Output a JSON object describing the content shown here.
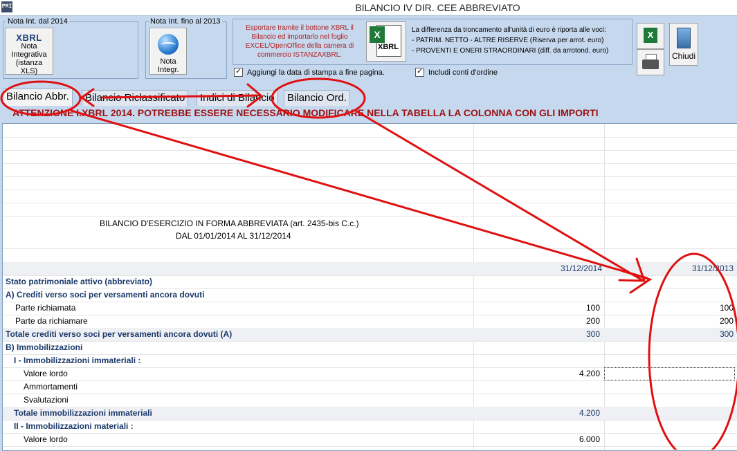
{
  "window": {
    "app_icon": "PMI",
    "title": "BILANCIO IV DIR. CEE ABBREVIATO"
  },
  "toolbar": {
    "group1_legend": "Nota Int. dal 2014",
    "group1_logo": "XBRL",
    "group1_button_label": "Nota Integrativa (istanza XLS)",
    "group2_legend": "Nota Int. fino al 2013",
    "group2_button_label": "Nota Integr.",
    "export_text": "Esportare tramite il bottone XBRL il Bilancio ed importarlo nel foglio EXCEL/OpenOffice della camera di commercio ISTANZAXBRL.",
    "xbrl_button_label": "XBRL",
    "rounding_note_line1": "La differenza da troncamento all'unità di euro è riporta alle voci:",
    "rounding_note_line2": "- PATRIM. NETTO - ALTRE RISERVE  (Riserva per arrot. euro)",
    "rounding_note_line3": "- PROVENTI E ONERI STRAORDINARI (diff. da  arrotond. euro)",
    "checkbox_print_date": "Aggiungi la data di stampa a fine pagina.",
    "checkbox_conti_ordine": "Includi conti d'ordine",
    "close_label": "Chiudi"
  },
  "tabs": [
    {
      "label": "Bilancio Abbr."
    },
    {
      "label": "Bilancio Riclassificato"
    },
    {
      "label": "Indici di Bilancio"
    },
    {
      "label": "Bilancio Ord."
    }
  ],
  "warning": "ATTENZIONE I.XBRL 2014. POTREBBE ESSERE NECESSARIO MODIFICARE NELLA TABELLA LA COLONNA CON GLI IMPORTI",
  "report": {
    "heading_line1": "BILANCIO D'ESERCIZIO IN FORMA ABBREVIATA (art. 2435-bis C.c.)",
    "heading_line2": "DAL 01/01/2014 AL 31/12/2014",
    "col_current": "31/12/2014",
    "col_previous": "31/12/2013",
    "rows": [
      {
        "label": "Stato patrimoniale attivo (abbreviato)",
        "style": "bold",
        "cur": "",
        "prev": ""
      },
      {
        "label": "A) Crediti verso soci per versamenti ancora dovuti",
        "style": "bold",
        "cur": "",
        "prev": ""
      },
      {
        "label": "Parte richiamata",
        "style": "sub2",
        "cur": "100",
        "prev": "100"
      },
      {
        "label": "Parte da richiamare",
        "style": "sub2",
        "cur": "200",
        "prev": "200"
      },
      {
        "label": "Totale crediti verso soci per versamenti ancora dovuti (A)",
        "style": "bold",
        "cur": "300",
        "prev": "300"
      },
      {
        "label": "B) Immobilizzazioni",
        "style": "bold",
        "cur": "",
        "prev": ""
      },
      {
        "label": "I - Immobilizzazioni immateriali :",
        "style": "bold1",
        "cur": "",
        "prev": ""
      },
      {
        "label": "Valore lordo",
        "style": "sub3",
        "cur": "4.200",
        "prev": ""
      },
      {
        "label": "Ammortamenti",
        "style": "sub3",
        "cur": "",
        "prev": ""
      },
      {
        "label": "Svalutazioni",
        "style": "sub3",
        "cur": "",
        "prev": ""
      },
      {
        "label": "Totale immobilizzazioni immateriali",
        "style": "bold1",
        "cur": "4.200",
        "prev": ""
      },
      {
        "label": "II - Immobilizzazioni materiali :",
        "style": "bold1",
        "cur": "",
        "prev": ""
      },
      {
        "label": "Valore lordo",
        "style": "sub3",
        "cur": "6.000",
        "prev": ""
      }
    ]
  },
  "colors": {
    "background": "#c6d8ee",
    "warning_text": "#9b1010",
    "label_blue": "#1b3a6b",
    "annotation_red": "#e01010"
  }
}
